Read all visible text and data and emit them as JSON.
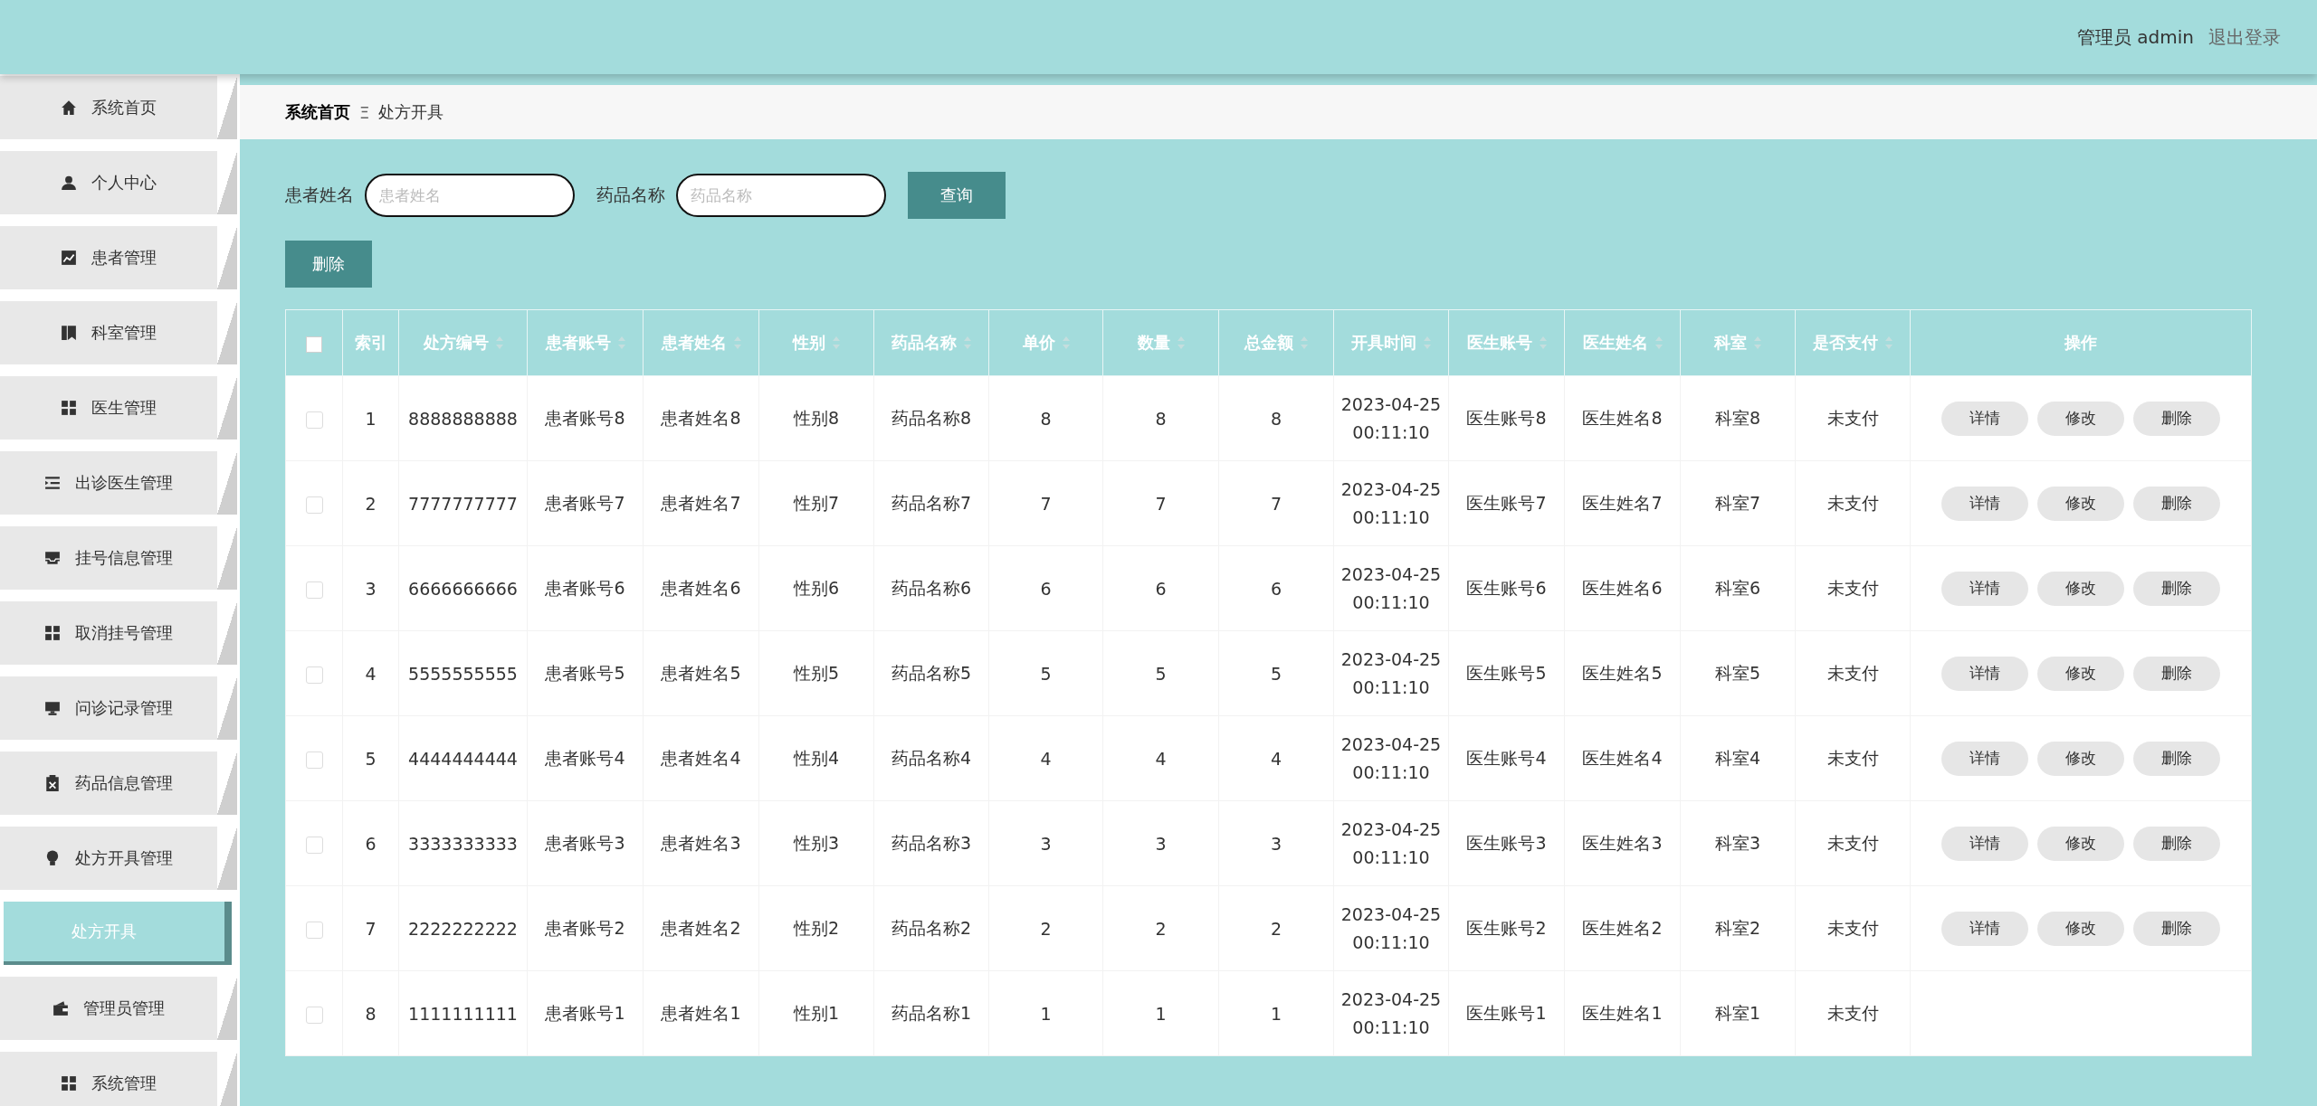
{
  "header": {
    "user": "管理员 admin",
    "logout": "退出登录"
  },
  "sidebar": {
    "items": [
      {
        "label": "系统首页",
        "selected": false
      },
      {
        "label": "个人中心",
        "selected": false
      },
      {
        "label": "患者管理",
        "selected": false
      },
      {
        "label": "科室管理",
        "selected": false
      },
      {
        "label": "医生管理",
        "selected": false
      },
      {
        "label": "出诊医生管理",
        "selected": false
      },
      {
        "label": "挂号信息管理",
        "selected": false
      },
      {
        "label": "取消挂号管理",
        "selected": false
      },
      {
        "label": "问诊记录管理",
        "selected": false
      },
      {
        "label": "药品信息管理",
        "selected": false
      },
      {
        "label": "处方开具管理",
        "selected": false,
        "children": [
          {
            "label": "处方开具",
            "selected": true
          }
        ]
      },
      {
        "label": "管理员管理",
        "selected": false
      },
      {
        "label": "系统管理",
        "selected": false
      }
    ]
  },
  "breadcrumb": {
    "items": [
      "系统首页",
      "处方开具"
    ],
    "separator": "Ξ"
  },
  "search": {
    "fields": [
      {
        "label": "患者姓名",
        "placeholder": "患者姓名"
      },
      {
        "label": "药品名称",
        "placeholder": "药品名称"
      }
    ],
    "button": "查询"
  },
  "delete_button": "删除",
  "table": {
    "select_all": {
      "checked": false
    },
    "columns": [
      "索引",
      "处方编号",
      "患者账号",
      "患者姓名",
      "性别",
      "药品名称",
      "单价",
      "数量",
      "总金额",
      "开具时间",
      "医生账号",
      "医生姓名",
      "科室",
      "是否支付",
      "操作"
    ],
    "rows": [
      {
        "checked": false,
        "cells": [
          "1",
          "8888888888",
          "患者账号8",
          "患者姓名8",
          "性别8",
          "药品名称8",
          "8",
          "8",
          "8",
          "2023-04-25 00:11:10",
          "医生账号8",
          "医生姓名8",
          "科室8",
          "未支付"
        ],
        "actions": [
          "详情",
          "修改",
          "删除"
        ]
      },
      {
        "checked": false,
        "cells": [
          "2",
          "7777777777",
          "患者账号7",
          "患者姓名7",
          "性别7",
          "药品名称7",
          "7",
          "7",
          "7",
          "2023-04-25 00:11:10",
          "医生账号7",
          "医生姓名7",
          "科室7",
          "未支付"
        ],
        "actions": [
          "详情",
          "修改",
          "删除"
        ]
      },
      {
        "checked": false,
        "cells": [
          "3",
          "6666666666",
          "患者账号6",
          "患者姓名6",
          "性别6",
          "药品名称6",
          "6",
          "6",
          "6",
          "2023-04-25 00:11:10",
          "医生账号6",
          "医生姓名6",
          "科室6",
          "未支付"
        ],
        "actions": [
          "详情",
          "修改",
          "删除"
        ]
      },
      {
        "checked": false,
        "cells": [
          "4",
          "5555555555",
          "患者账号5",
          "患者姓名5",
          "性别5",
          "药品名称5",
          "5",
          "5",
          "5",
          "2023-04-25 00:11:10",
          "医生账号5",
          "医生姓名5",
          "科室5",
          "未支付"
        ],
        "actions": [
          "详情",
          "修改",
          "删除"
        ]
      },
      {
        "checked": false,
        "cells": [
          "5",
          "4444444444",
          "患者账号4",
          "患者姓名4",
          "性别4",
          "药品名称4",
          "4",
          "4",
          "4",
          "2023-04-25 00:11:10",
          "医生账号4",
          "医生姓名4",
          "科室4",
          "未支付"
        ],
        "actions": [
          "详情",
          "修改",
          "删除"
        ]
      },
      {
        "checked": false,
        "cells": [
          "6",
          "3333333333",
          "患者账号3",
          "患者姓名3",
          "性别3",
          "药品名称3",
          "3",
          "3",
          "3",
          "2023-04-25 00:11:10",
          "医生账号3",
          "医生姓名3",
          "科室3",
          "未支付"
        ],
        "actions": [
          "详情",
          "修改",
          "删除"
        ]
      },
      {
        "checked": false,
        "cells": [
          "7",
          "2222222222",
          "患者账号2",
          "患者姓名2",
          "性别2",
          "药品名称2",
          "2",
          "2",
          "2",
          "2023-04-25 00:11:10",
          "医生账号2",
          "医生姓名2",
          "科室2",
          "未支付"
        ],
        "actions": [
          "详情",
          "修改",
          "删除"
        ]
      },
      {
        "checked": false,
        "cells": [
          "8",
          "1111111111",
          "患者账号1",
          "患者姓名1",
          "性别1",
          "药品名称1",
          "1",
          "1",
          "1",
          "2023-04-25 00:11:10",
          "医生账号1",
          "医生姓名1",
          "科室1",
          "未支付"
        ]
      }
    ]
  }
}
